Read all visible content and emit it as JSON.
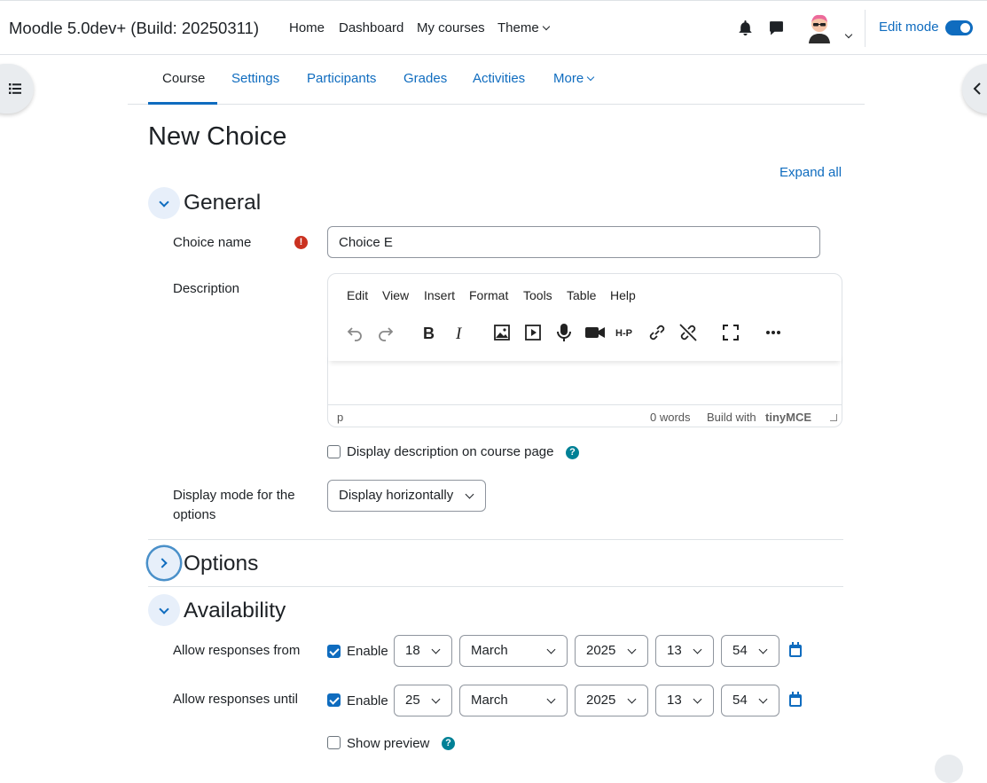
{
  "navbar": {
    "brand": "Moodle 5.0dev+ (Build: 20250311)",
    "links": [
      "Home",
      "Dashboard",
      "My courses",
      "Theme"
    ],
    "edit_mode_label": "Edit mode",
    "edit_mode_on": true
  },
  "secondary_nav": {
    "tabs": [
      "Course",
      "Settings",
      "Participants",
      "Grades",
      "Activities",
      "More"
    ],
    "active": "Course"
  },
  "page": {
    "title": "New Choice",
    "expand_all": "Expand all"
  },
  "general": {
    "title": "General",
    "choice_name_label": "Choice name",
    "choice_name_value": "Choice E",
    "description_label": "Description",
    "editor_menu": [
      "Edit",
      "View",
      "Insert",
      "Format",
      "Tools",
      "Table",
      "Help"
    ],
    "editor_status_path": "p",
    "editor_word_count": "0 words",
    "editor_brand": "Build with",
    "editor_brand_logo": "tinyMCE",
    "display_desc_label": "Display description on course page",
    "display_desc_checked": false,
    "display_mode_label": "Display mode for the options",
    "display_mode_value": "Display horizontally"
  },
  "options": {
    "title": "Options"
  },
  "availability": {
    "title": "Availability",
    "from_label": "Allow responses from",
    "until_label": "Allow responses until",
    "enable_label": "Enable",
    "from": {
      "enabled": true,
      "day": "18",
      "month": "March",
      "year": "2025",
      "hour": "13",
      "minute": "54"
    },
    "until": {
      "enabled": true,
      "day": "25",
      "month": "March",
      "year": "2025",
      "hour": "13",
      "minute": "54"
    },
    "show_preview_label": "Show preview",
    "show_preview_checked": false
  },
  "colors": {
    "primary": "#0f6cbf",
    "required": "#ca3120",
    "help": "#008196",
    "text": "#1d2125"
  }
}
